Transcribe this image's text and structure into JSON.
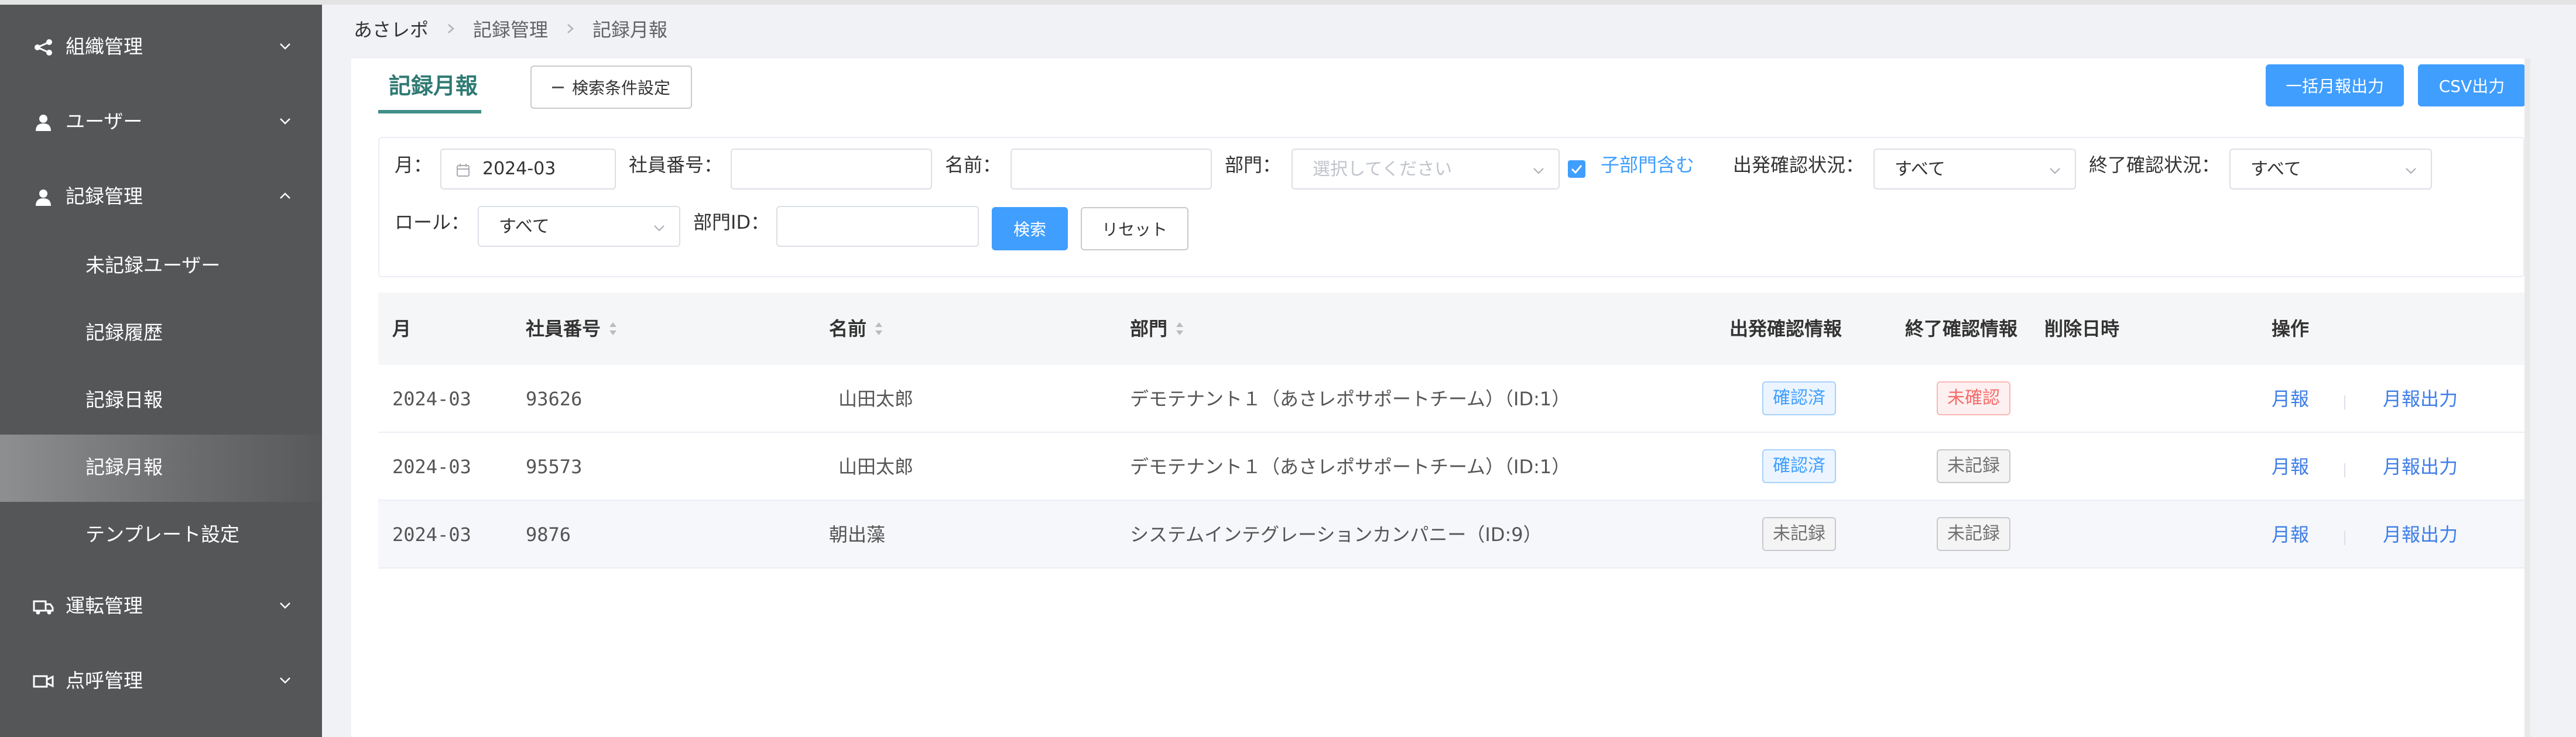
{
  "sidebar": {
    "groups": [
      {
        "label": "組織管理",
        "icon": "share-icon"
      },
      {
        "label": "ユーザー",
        "icon": "user-icon"
      },
      {
        "label": "記録管理",
        "icon": "user-icon"
      },
      {
        "label": "運転管理",
        "icon": "truck-icon"
      },
      {
        "label": "点呼管理",
        "icon": "video-icon"
      }
    ],
    "record_items": [
      {
        "label": "未記録ユーザー"
      },
      {
        "label": "記録履歴"
      },
      {
        "label": "記録日報"
      },
      {
        "label": "記録月報"
      },
      {
        "label": "テンプレート設定"
      }
    ],
    "active_item": "記録月報"
  },
  "breadcrumb": [
    "あさレポ",
    "記録管理",
    "記録月報"
  ],
  "page": {
    "tab_title": "記録月報",
    "search_conditions_label": "検索条件設定",
    "bulk_monthly_output_label": "一括月報出力",
    "csv_output_label": "CSV出力"
  },
  "filters": {
    "month_label": "月：",
    "month_value": "2024-03",
    "employee_no_label": "社員番号：",
    "employee_no_value": "",
    "name_label": "名前：",
    "name_value": "",
    "department_label": "部門：",
    "department_placeholder": "選択してください",
    "include_sub_label": "子部門含む",
    "include_sub_checked": true,
    "departure_status_label": "出発確認状況：",
    "departure_status_value": "すべて",
    "end_status_label": "終了確認状況：",
    "end_status_value": "すべて",
    "role_label": "ロール：",
    "role_value": "すべて",
    "department_id_label": "部門ID：",
    "department_id_value": "",
    "search_label": "検索",
    "reset_label": "リセット"
  },
  "table": {
    "headers": {
      "month": "月",
      "employee_no": "社員番号",
      "name": "名前",
      "department": "部門",
      "departure_info": "出発確認情報",
      "end_info": "終了確認情報",
      "deleted_at": "削除日時",
      "actions": "操作"
    },
    "rows": [
      {
        "month": "2024-03",
        "employee_no": "93626",
        "name": "山田太郎",
        "department": "デモテナント１（あさレポサポートチーム）（ID:1）",
        "departure": "確認済",
        "departure_status": "ok",
        "end": "未確認",
        "end_status": "ng",
        "deleted_at": "",
        "action_report": "月報",
        "action_output": "月報出力"
      },
      {
        "month": "2024-03",
        "employee_no": "95573",
        "name": "山田太郎",
        "department": "デモテナント１（あさレポサポートチーム）（ID:1）",
        "departure": "確認済",
        "departure_status": "ok",
        "end": "未記録",
        "end_status": "none",
        "deleted_at": "",
        "action_report": "月報",
        "action_output": "月報出力"
      },
      {
        "month": "2024-03",
        "employee_no": "9876",
        "name": "朝出藻",
        "department": "システムインテグレーションカンパニー（ID:9）",
        "departure": "未記録",
        "departure_status": "none",
        "end": "未記録",
        "end_status": "none",
        "deleted_at": "",
        "action_report": "月報",
        "action_output": "月報出力"
      }
    ]
  },
  "colors": {
    "sidebar_bg": "#555658",
    "accent_teal": "#2f7a73",
    "primary_blue": "#409eff",
    "danger_red": "#f56c6c"
  }
}
